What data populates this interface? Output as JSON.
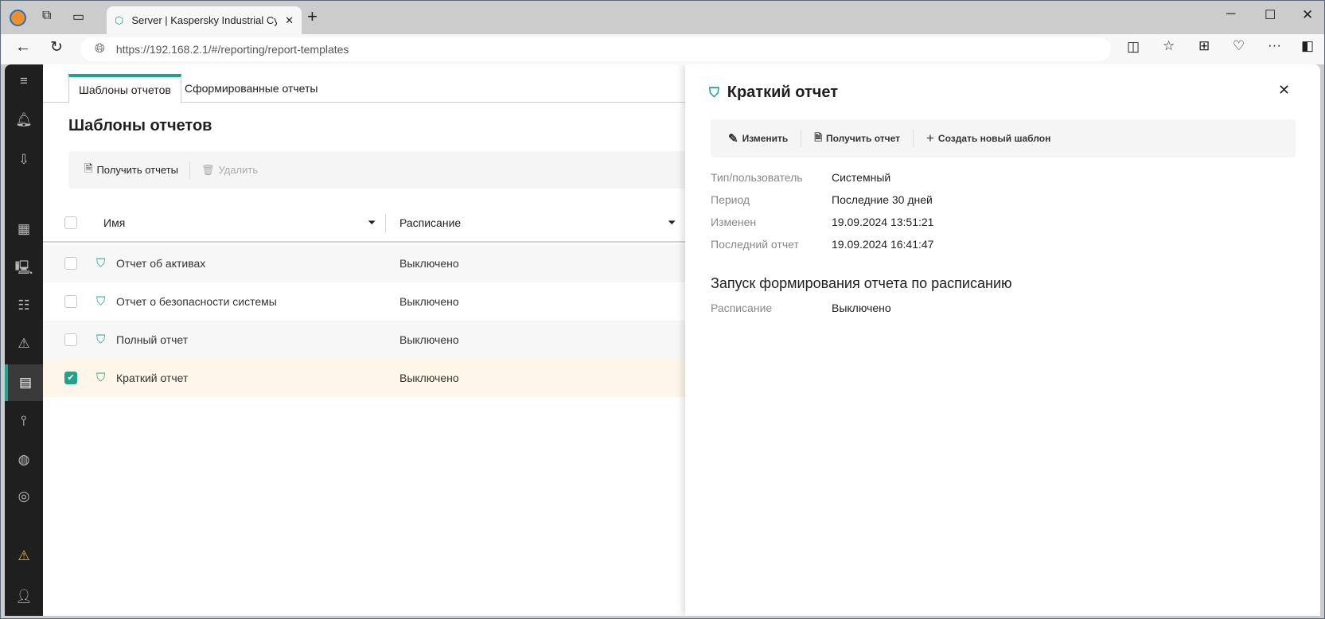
{
  "browser": {
    "tab_title": "Server | Kaspersky Industrial Cybe",
    "url": "https://192.168.2.1/#/reporting/report-templates"
  },
  "main": {
    "tabs": [
      {
        "label": "Шаблоны отчетов"
      },
      {
        "label": "Сформированные отчеты"
      }
    ],
    "title": "Шаблоны отчетов",
    "toolbar": {
      "get_reports": "Получить отчеты",
      "delete": "Удалить"
    },
    "columns": {
      "name": "Имя",
      "schedule": "Расписание"
    },
    "rows": [
      {
        "name": "Отчет об активах",
        "schedule": "Выключено",
        "checked": false
      },
      {
        "name": "Отчет о безопасности системы",
        "schedule": "Выключено",
        "checked": false
      },
      {
        "name": "Полный отчет",
        "schedule": "Выключено",
        "checked": false
      },
      {
        "name": "Краткий отчет",
        "schedule": "Выключено",
        "checked": true
      }
    ]
  },
  "panel": {
    "title": "Краткий отчет",
    "toolbar": {
      "edit": "Изменить",
      "get_report": "Получить отчет",
      "create": "Создать новый шаблон"
    },
    "props": [
      {
        "label": "Тип/пользователь",
        "value": "Системный"
      },
      {
        "label": "Период",
        "value": "Последние 30 дней"
      },
      {
        "label": "Изменен",
        "value": "19.09.2024 13:51:21"
      },
      {
        "label": "Последний отчет",
        "value": "19.09.2024 16:41:47"
      }
    ],
    "section": "Запуск формирования отчета по расписанию",
    "schedule": {
      "label": "Расписание",
      "value": "Выключено"
    }
  },
  "colors": {
    "accent": "#21a38b",
    "selected_row": "#fdf6e9",
    "sidebar": "#1f1f1f"
  }
}
